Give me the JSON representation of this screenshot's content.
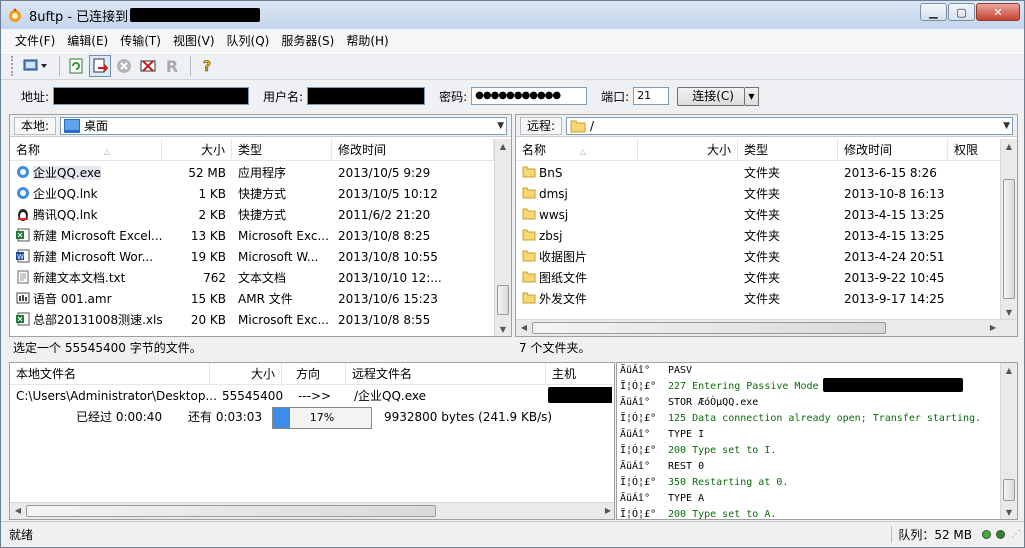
{
  "window": {
    "title": "8uftp - 已连接到"
  },
  "menu": [
    "文件(F)",
    "编辑(E)",
    "传输(T)",
    "视图(V)",
    "队列(Q)",
    "服务器(S)",
    "帮助(H)"
  ],
  "connection": {
    "address_label": "地址:",
    "user_label": "用户名:",
    "password_label": "密码:",
    "password_value": "●●●●●●●●●●●",
    "port_label": "端口:",
    "port_value": "21",
    "connect_button": "连接(C)"
  },
  "local": {
    "label": "本地:",
    "path": "桌面",
    "columns": [
      "名称",
      "大小",
      "类型",
      "修改时间"
    ],
    "files": [
      {
        "name": "企业QQ.exe",
        "size": "52 MB",
        "type": "应用程序",
        "modified": "2013/10/5 9:29",
        "icon": "qq-exe-icon"
      },
      {
        "name": "企业QQ.lnk",
        "size": "1 KB",
        "type": "快捷方式",
        "modified": "2013/10/5 10:12",
        "icon": "qq-lnk-icon"
      },
      {
        "name": "腾讯QQ.lnk",
        "size": "2 KB",
        "type": "快捷方式",
        "modified": "2011/6/2 21:20",
        "icon": "penguin-icon"
      },
      {
        "name": "新建 Microsoft Excel...",
        "size": "13 KB",
        "type": "Microsoft Exc...",
        "modified": "2013/10/8 8:25",
        "icon": "excel-icon"
      },
      {
        "name": "新建 Microsoft Wor...",
        "size": "19 KB",
        "type": "Microsoft W...",
        "modified": "2013/10/8 10:55",
        "icon": "word-icon"
      },
      {
        "name": "新建文本文档.txt",
        "size": "762",
        "type": "文本文档",
        "modified": "2013/10/10 12:...",
        "icon": "text-icon"
      },
      {
        "name": "语音 001.amr",
        "size": "15 KB",
        "type": "AMR 文件",
        "modified": "2013/10/6 15:23",
        "icon": "audio-icon"
      },
      {
        "name": "总部20131008测速.xls",
        "size": "20 KB",
        "type": "Microsoft Exc...",
        "modified": "2013/10/8 8:55",
        "icon": "excel-icon"
      }
    ],
    "status": "选定一个 55545400 字节的文件。"
  },
  "remote": {
    "label": "远程:",
    "path": "/",
    "columns": [
      "名称",
      "大小",
      "类型",
      "修改时间",
      "权限"
    ],
    "files": [
      {
        "name": "BnS",
        "type": "文件夹",
        "modified": "2013-6-15 8:26"
      },
      {
        "name": "dmsj",
        "type": "文件夹",
        "modified": "2013-10-8 16:13"
      },
      {
        "name": "wwsj",
        "type": "文件夹",
        "modified": "2013-4-15 13:25"
      },
      {
        "name": "zbsj",
        "type": "文件夹",
        "modified": "2013-4-15 13:25"
      },
      {
        "name": "收据图片",
        "type": "文件夹",
        "modified": "2013-4-24 20:51"
      },
      {
        "name": "图纸文件",
        "type": "文件夹",
        "modified": "2013-9-22 10:45"
      },
      {
        "name": "外发文件",
        "type": "文件夹",
        "modified": "2013-9-17 14:25"
      }
    ],
    "status": "7 个文件夹。"
  },
  "queue": {
    "columns": [
      "本地文件名",
      "大小",
      "方向",
      "远程文件名",
      "主机"
    ],
    "item": {
      "local": "C:\\Users\\Administrator\\Desktop...",
      "size": "55545400",
      "direction": "--->>",
      "remote": "/企业QQ.exe"
    },
    "elapsed": "已经过 0:00:40",
    "remaining": "还有 0:03:03",
    "progress_percent": 17,
    "progress_label": "17%",
    "rate": "9932800 bytes (241.9 KB/s)"
  },
  "log": [
    {
      "prefix": "ÃüÁî°",
      "text": "PASV",
      "kind": "cmd"
    },
    {
      "prefix": "Ï¦Ó¦£°",
      "text": "227 Entering Passive Mode",
      "kind": "resp"
    },
    {
      "prefix": "ÃüÁî°",
      "text": "STOR ÆóÒµQQ.exe",
      "kind": "cmd"
    },
    {
      "prefix": "Ï¦Ó¦£°",
      "text": "125 Data connection already open; Transfer starting.",
      "kind": "resp"
    },
    {
      "prefix": "ÃüÁî°",
      "text": "TYPE I",
      "kind": "cmd"
    },
    {
      "prefix": "Ï¦Ó¦£°",
      "text": "200 Type set to I.",
      "kind": "resp"
    },
    {
      "prefix": "ÃüÁî°",
      "text": "REST 0",
      "kind": "cmd"
    },
    {
      "prefix": "Ï¦Ó¦£°",
      "text": "350 Restarting at 0.",
      "kind": "resp"
    },
    {
      "prefix": "ÃüÁî°",
      "text": "TYPE A",
      "kind": "cmd"
    },
    {
      "prefix": "Ï¦Ó¦£°",
      "text": "200 Type set to A.",
      "kind": "resp"
    }
  ],
  "status": {
    "ready": "就绪",
    "queue": "队列：52 MB"
  },
  "colors": {
    "accent": "#3c8de8",
    "log_response": "#0a6e0a"
  }
}
